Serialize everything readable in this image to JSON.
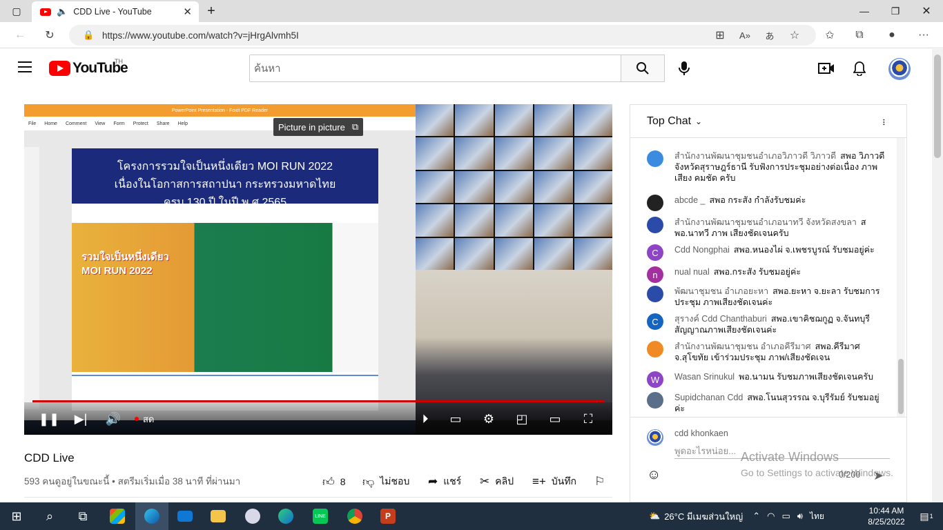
{
  "browser": {
    "tab_title": "CDD Live - YouTube",
    "url": "https://www.youtube.com/watch?v=jHrgAlvmh5I"
  },
  "youtube": {
    "logo_text": "YouTube",
    "region": "TH",
    "search_placeholder": "ค้นหา"
  },
  "player": {
    "pdf_title": "PowerPoint Presentation - Foxit PDF Reader",
    "pdf_menu": [
      "File",
      "Home",
      "Comment",
      "View",
      "Form",
      "Protect",
      "Share",
      "Help"
    ],
    "slide_heading_1": "โครงการรวมใจเป็นหนึ่งเดียว MOI RUN 2022",
    "slide_heading_2": "เนื่องในโอกาสการสถาปนา กระทรวงมหาดไทย",
    "slide_heading_3": "ครบ 130 ปี ในปี พ.ศ.2565",
    "slide_art_text": "รวมใจเป็นหนึ่งเดียว MOI RUN 2022",
    "pip_tooltip": "Picture in picture",
    "live_label": "สด"
  },
  "video": {
    "title": "CDD Live",
    "meta": "593 คนดูอยู่ในขณะนี้ • สตรีมเริ่มเมื่อ 38 นาที ที่ผ่านมา",
    "likes": "8",
    "dislike_label": "ไม่ชอบ",
    "share_label": "แชร์",
    "clip_label": "คลิป",
    "save_label": "บันทึก"
  },
  "chat": {
    "header": "Top Chat",
    "messages": [
      {
        "author": "สำนักงานพัฒนาชุมชนอำเภอวิภาวดี วิภาวดี",
        "text": "สพอ วิภาวดี จังหวัดสุราษฎร์ธานี รับฟังการประชุมอย่างต่อเนื่อง ภาพ เสียง คมชัด ครับ",
        "avatar_color": "#3b8ce0",
        "initial": ""
      },
      {
        "author": "abcde _",
        "text": "สพอ กระสัง กำลังรับชมค่ะ",
        "avatar_color": "#222222",
        "initial": ""
      },
      {
        "author": "สำนักงานพัฒนาชุมชนอำเภอนาทวี จังหวัดสงขลา",
        "text": "สพอ.นาทวี ภาพ เสียงชัดเจนครับ",
        "avatar_color": "#2a4ba8",
        "initial": ""
      },
      {
        "author": "Cdd Nongphai",
        "text": "สพอ.หนองไผ่ จ.เพชรบูรณ์ รับชมอยู่ค่ะ",
        "avatar_color": "#8e44c7",
        "initial": "C"
      },
      {
        "author": "nual nual",
        "text": "สพอ.กระสัง รับชมอยู่ค่ะ",
        "avatar_color": "#a3309e",
        "initial": "n"
      },
      {
        "author": "พัฒนาชุมชน อำเภอยะหา",
        "text": "สพอ.ยะหา จ.ยะลา รับชมการประชุม ภาพเสียงชัดเจนค่ะ",
        "avatar_color": "#2a4ba8",
        "initial": ""
      },
      {
        "author": "สุรางค์ Cdd Chanthaburi",
        "text": "สพอ.เขาคิชฌกูฏ จ.จันทบุรี สัญญาณภาพเสียงชัดเจนค่ะ",
        "avatar_color": "#1565c0",
        "initial": "C"
      },
      {
        "author": "สำนักงานพัฒนาชุมชน อำเภอคีรีมาศ",
        "text": "สพอ.คีรีมาศ จ.สุโขทัย เข้าร่วมประชุม ภาพ/เสียงชัดเจน",
        "avatar_color": "#f08a24",
        "initial": ""
      },
      {
        "author": "Wasan Srinukul",
        "text": "พอ.นามน รับชมภาพเสียงชัดเจนครับ",
        "avatar_color": "#8e44c7",
        "initial": "W"
      },
      {
        "author": "Supidchanan Cdd",
        "text": "สพอ.โนนสุวรรณ จ.บุรีรัมย์ รับชมอยู่ค่ะ",
        "avatar_color": "#5b6f8a",
        "initial": ""
      }
    ],
    "input_name": "cdd khonkaen",
    "input_placeholder": "พูดอะไรหน่อย...",
    "char_count": "0/200"
  },
  "watermark": {
    "line1": "Activate Windows",
    "line2": "Go to Settings to activate Windows."
  },
  "taskbar": {
    "weather": "26°C  มีเมฆส่วนใหญ่",
    "lang": "ไทย",
    "time": "10:44 AM",
    "date": "8/25/2022",
    "notifications": "1"
  }
}
